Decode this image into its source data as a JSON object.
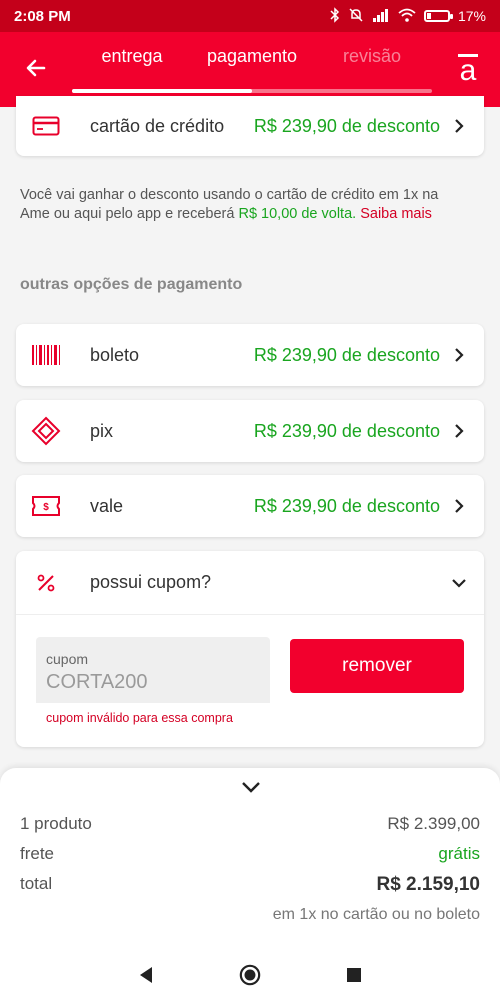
{
  "status_bar": {
    "time": "2:08 PM",
    "battery": "17%"
  },
  "header": {
    "steps": [
      "entrega",
      "pagamento",
      "revisão"
    ],
    "progress_fraction": 0.5,
    "logo": "a"
  },
  "credit_card": {
    "name": "cartão de crédito",
    "discount": "R$ 239,90 de desconto"
  },
  "info": {
    "text": "Você vai ganhar o desconto usando o cartão de crédito em 1x na Ame ou aqui pelo app e receberá ",
    "cashback": "R$ 10,00 de volta.",
    "link": "Saiba mais"
  },
  "other_options_title": "outras opções de pagamento",
  "options": [
    {
      "name": "boleto",
      "discount": "R$ 239,90 de desconto",
      "icon": "barcode-icon"
    },
    {
      "name": "pix",
      "discount": "R$ 239,90 de desconto",
      "icon": "pix-icon"
    },
    {
      "name": "vale",
      "discount": "R$ 239,90 de desconto",
      "icon": "voucher-icon"
    }
  ],
  "coupon": {
    "title": "possui cupom?",
    "label": "cupom",
    "value": "CORTA200",
    "error": "cupom inválido para essa compra",
    "button": "remover"
  },
  "summary": {
    "products_label": "1 produto",
    "products_value": "R$ 2.399,00",
    "shipping_label": "frete",
    "shipping_value": "grátis",
    "total_label": "total",
    "total_value": "R$ 2.159,10",
    "hint": "em 1x no cartão ou no boleto"
  },
  "colors": {
    "brand": "#f2002d",
    "discount": "#19a51f"
  }
}
